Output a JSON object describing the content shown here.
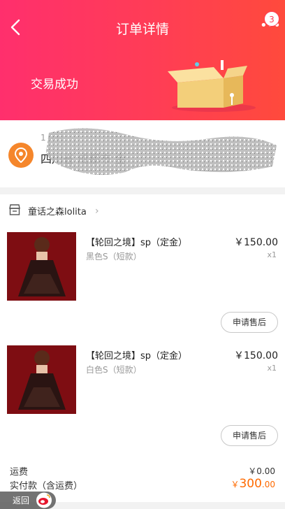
{
  "header": {
    "title": "订单详情",
    "status": "交易成功",
    "badge_count": "3",
    "colors": {
      "gradient_start": "#ff2f6d",
      "gradient_end": "#ff4a3c"
    }
  },
  "address": {
    "line1": "1 032",
    "line2": "四川省 成都市 金"
  },
  "shop": {
    "name": "童话之森lolita"
  },
  "items": [
    {
      "title": "【轮回之境】sp（定金）",
      "variant": "黑色S（短款）",
      "price": "￥150.00",
      "qty": "x1",
      "action": "申请售后"
    },
    {
      "title": "【轮回之境】sp（定金）",
      "variant": "白色S（短款）",
      "price": "￥150.00",
      "qty": "x1",
      "action": "申请售后"
    }
  ],
  "fees": {
    "shipping_label": "运费",
    "shipping_value": "￥0.00",
    "total_label": "实付款（含运费）",
    "total_currency": "￥",
    "total_int": "300",
    "total_dec": ".00"
  },
  "footer": {
    "back_label": "返回"
  }
}
